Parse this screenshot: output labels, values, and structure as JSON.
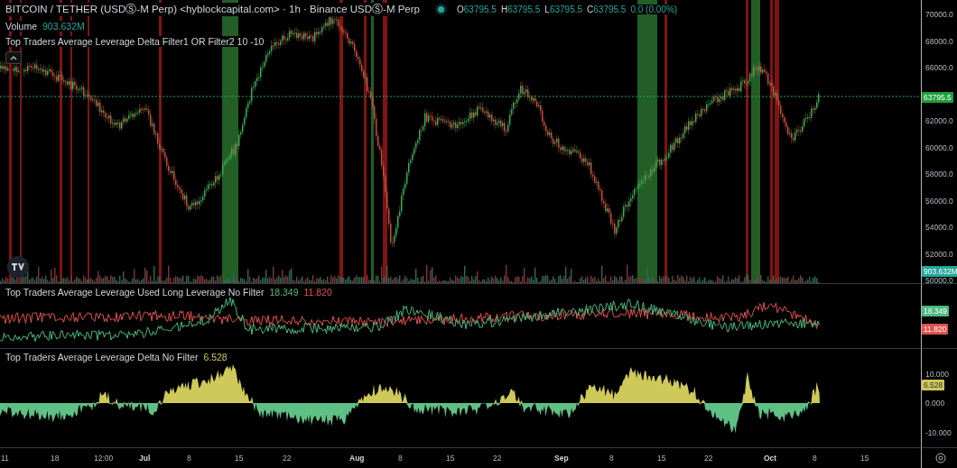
{
  "header": {
    "title": "BITCOIN / TETHER (USDⓈ-M Perp) <hyblockcapital.com> · 1h · Binance USDⓈ-M Perp",
    "market_open": true,
    "ohlc": [
      {
        "key": "O",
        "value": "63795.5"
      },
      {
        "key": "H",
        "value": "63795.5"
      },
      {
        "key": "L",
        "value": "63795.5"
      },
      {
        "key": "C",
        "value": "63795.5"
      }
    ],
    "change": "0.0 (0.00%)"
  },
  "main_pane": {
    "indicators": [
      {
        "name": "Volume",
        "value": "903.632M"
      },
      {
        "name": "Top Traders Average Leverage Delta Filter1 OR Filter2 10 -10"
      }
    ],
    "price_axis": [
      "70000.0",
      "68000.0",
      "66000.0",
      "62000.0",
      "60000.0",
      "58000.0",
      "56000.0",
      "54000.0",
      "52000.0",
      "50000.0"
    ],
    "last_price": "63795.5",
    "volume_tag": "903.632M"
  },
  "leverage_pane": {
    "title": "Top Traders Average Leverage Used Long Leverage No Filter",
    "values": [
      {
        "text": "18.349",
        "color": "#4cbb7f"
      },
      {
        "text": "11.820",
        "color": "#e0524f"
      }
    ],
    "tags": [
      {
        "text": "18.349",
        "color": "#4cbb7f"
      },
      {
        "text": "11.820",
        "color": "#e0524f"
      }
    ]
  },
  "delta_pane": {
    "title": "Top Traders Average Leverage Delta No Filter",
    "value": "6.528",
    "axis": [
      "10.000",
      "0.000",
      "-10.000"
    ],
    "tag": "6.528"
  },
  "time_axis": [
    {
      "label": "11",
      "kind": "day"
    },
    {
      "label": "18",
      "kind": "day"
    },
    {
      "label": "12:00",
      "kind": "time"
    },
    {
      "label": "Jul",
      "kind": "month"
    },
    {
      "label": "8",
      "kind": "day"
    },
    {
      "label": "15",
      "kind": "day"
    },
    {
      "label": "22",
      "kind": "day"
    },
    {
      "label": "Aug",
      "kind": "month"
    },
    {
      "label": "8",
      "kind": "day"
    },
    {
      "label": "15",
      "kind": "day"
    },
    {
      "label": "22",
      "kind": "day"
    },
    {
      "label": "Sep",
      "kind": "month"
    },
    {
      "label": "8",
      "kind": "day"
    },
    {
      "label": "15",
      "kind": "day"
    },
    {
      "label": "22",
      "kind": "day"
    },
    {
      "label": "Oct",
      "kind": "month"
    },
    {
      "label": "8",
      "kind": "day"
    },
    {
      "label": "15",
      "kind": "day"
    }
  ]
}
